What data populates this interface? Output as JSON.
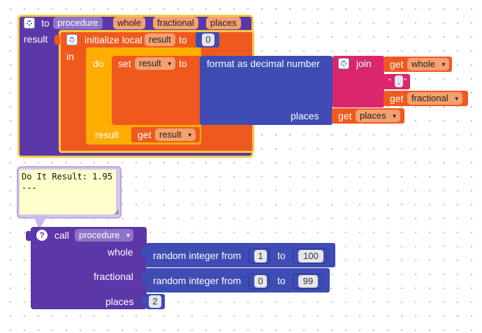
{
  "colors": {
    "procedure": "#5b37a8",
    "variable": "#f0591e",
    "control": "#ffad00",
    "math": "#3e4cb3",
    "text": "#d9266c",
    "highlight": "#f7c948",
    "comment_bg": "#ffffcc"
  },
  "proc_def": {
    "keyword": "to",
    "name": "procedure",
    "params": [
      "whole",
      "fractional",
      "places"
    ],
    "result_label": "result"
  },
  "local_init": {
    "label": "initialize local",
    "var_name": "result",
    "to_label": "to",
    "value": "0",
    "in_label": "in"
  },
  "do_block": {
    "do_label": "do",
    "result_label": "result"
  },
  "set_block": {
    "set_label": "set",
    "var_name": "result",
    "to_label": "to"
  },
  "format_block": {
    "label": "format as decimal number",
    "places_label": "places"
  },
  "join_block": {
    "label": "join"
  },
  "get_whole": {
    "get_label": "get",
    "var_name": "whole"
  },
  "text_literal": {
    "value": "."
  },
  "get_fractional": {
    "get_label": "get",
    "var_name": "fractional"
  },
  "get_places": {
    "get_label": "get",
    "var_name": "places"
  },
  "get_result": {
    "get_label": "get",
    "var_name": "result"
  },
  "comment": {
    "text": "Do It Result: 1.95\n---"
  },
  "call_block": {
    "call_label": "call",
    "proc_name": "procedure",
    "arg_whole": "whole",
    "arg_fractional": "fractional",
    "arg_places": "places"
  },
  "random1": {
    "label": "random integer from",
    "from": "1",
    "to_label": "to",
    "to": "100"
  },
  "random2": {
    "label": "random integer from",
    "from": "0",
    "to_label": "to",
    "to": "99"
  },
  "places_value": "2"
}
